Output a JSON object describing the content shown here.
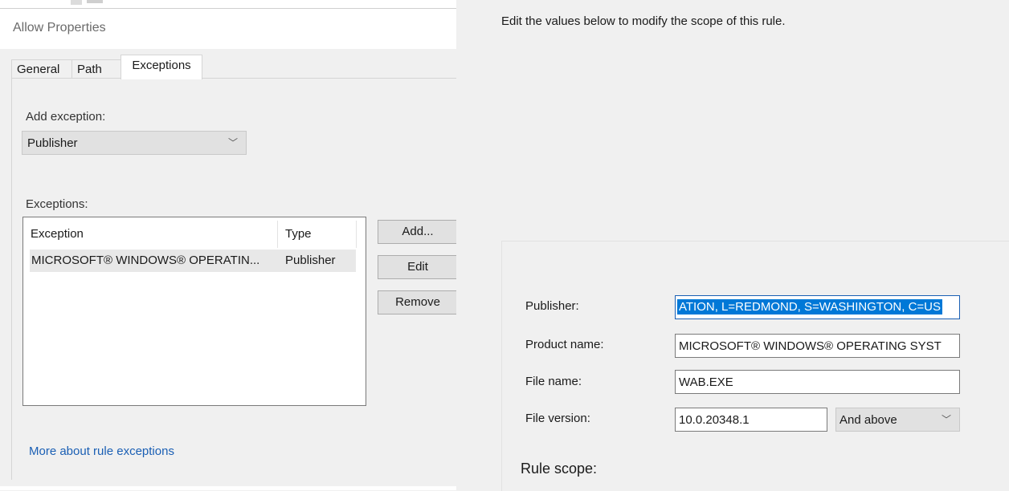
{
  "left_dialog": {
    "title": "Allow Properties",
    "tabs": [
      {
        "label": "General"
      },
      {
        "label": "Path"
      },
      {
        "label": "Exceptions"
      }
    ],
    "add_exception_label": "Add exception:",
    "exception_type_selected": "Publisher",
    "exceptions_label": "Exceptions:",
    "list": {
      "columns": [
        "Exception",
        "Type"
      ],
      "rows": [
        {
          "exception": "MICROSOFT® WINDOWS® OPERATIN...",
          "type": "Publisher"
        }
      ]
    },
    "buttons": {
      "add": "Add...",
      "edit": "Edit",
      "remove": "Remove"
    },
    "more_link": "More about rule exceptions"
  },
  "right_pane": {
    "description": "Edit the values below to modify the scope of this rule.",
    "fields": {
      "publisher_label": "Publisher:",
      "publisher_value": "ATION, L=REDMOND, S=WASHINGTON, C=US",
      "product_label": "Product name:",
      "product_value": "MICROSOFT® WINDOWS® OPERATING SYST",
      "file_label": "File name:",
      "file_value": "WAB.EXE",
      "version_label": "File version:",
      "version_value": "10.0.20348.1",
      "version_mode": "And above"
    },
    "rule_scope": "Rule scope:"
  },
  "icons": {
    "dropdown": "chevron-down-icon"
  },
  "colors": {
    "selection": "#0078d7",
    "link": "#1a5fb4",
    "dialog_bg": "#f0f0f0"
  }
}
